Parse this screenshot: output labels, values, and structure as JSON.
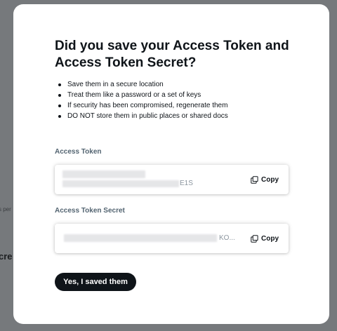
{
  "background": {
    "fragment_small": "s per",
    "fragment_heading": "cre"
  },
  "modal": {
    "title": "Did you save your Access Token and Access Token Secret?",
    "bullets": [
      "Save them in a secure location",
      "Treat them like a password or a set of keys",
      "If security has been compromised, regenerate them",
      "DO NOT store them in public places or shared docs"
    ],
    "access_token": {
      "label": "Access Token",
      "visible_suffix": "E1S",
      "copy_label": "Copy",
      "copy_icon": "copy-icon"
    },
    "access_token_secret": {
      "label": "Access Token Secret",
      "visible_suffix": "KO...",
      "copy_label": "Copy",
      "copy_icon": "copy-icon"
    },
    "confirm_button": "Yes, I saved them"
  },
  "colors": {
    "overlay": "#76797c",
    "modal_bg": "#ffffff",
    "primary_button": "#0f1419",
    "label_gray": "#536471"
  }
}
